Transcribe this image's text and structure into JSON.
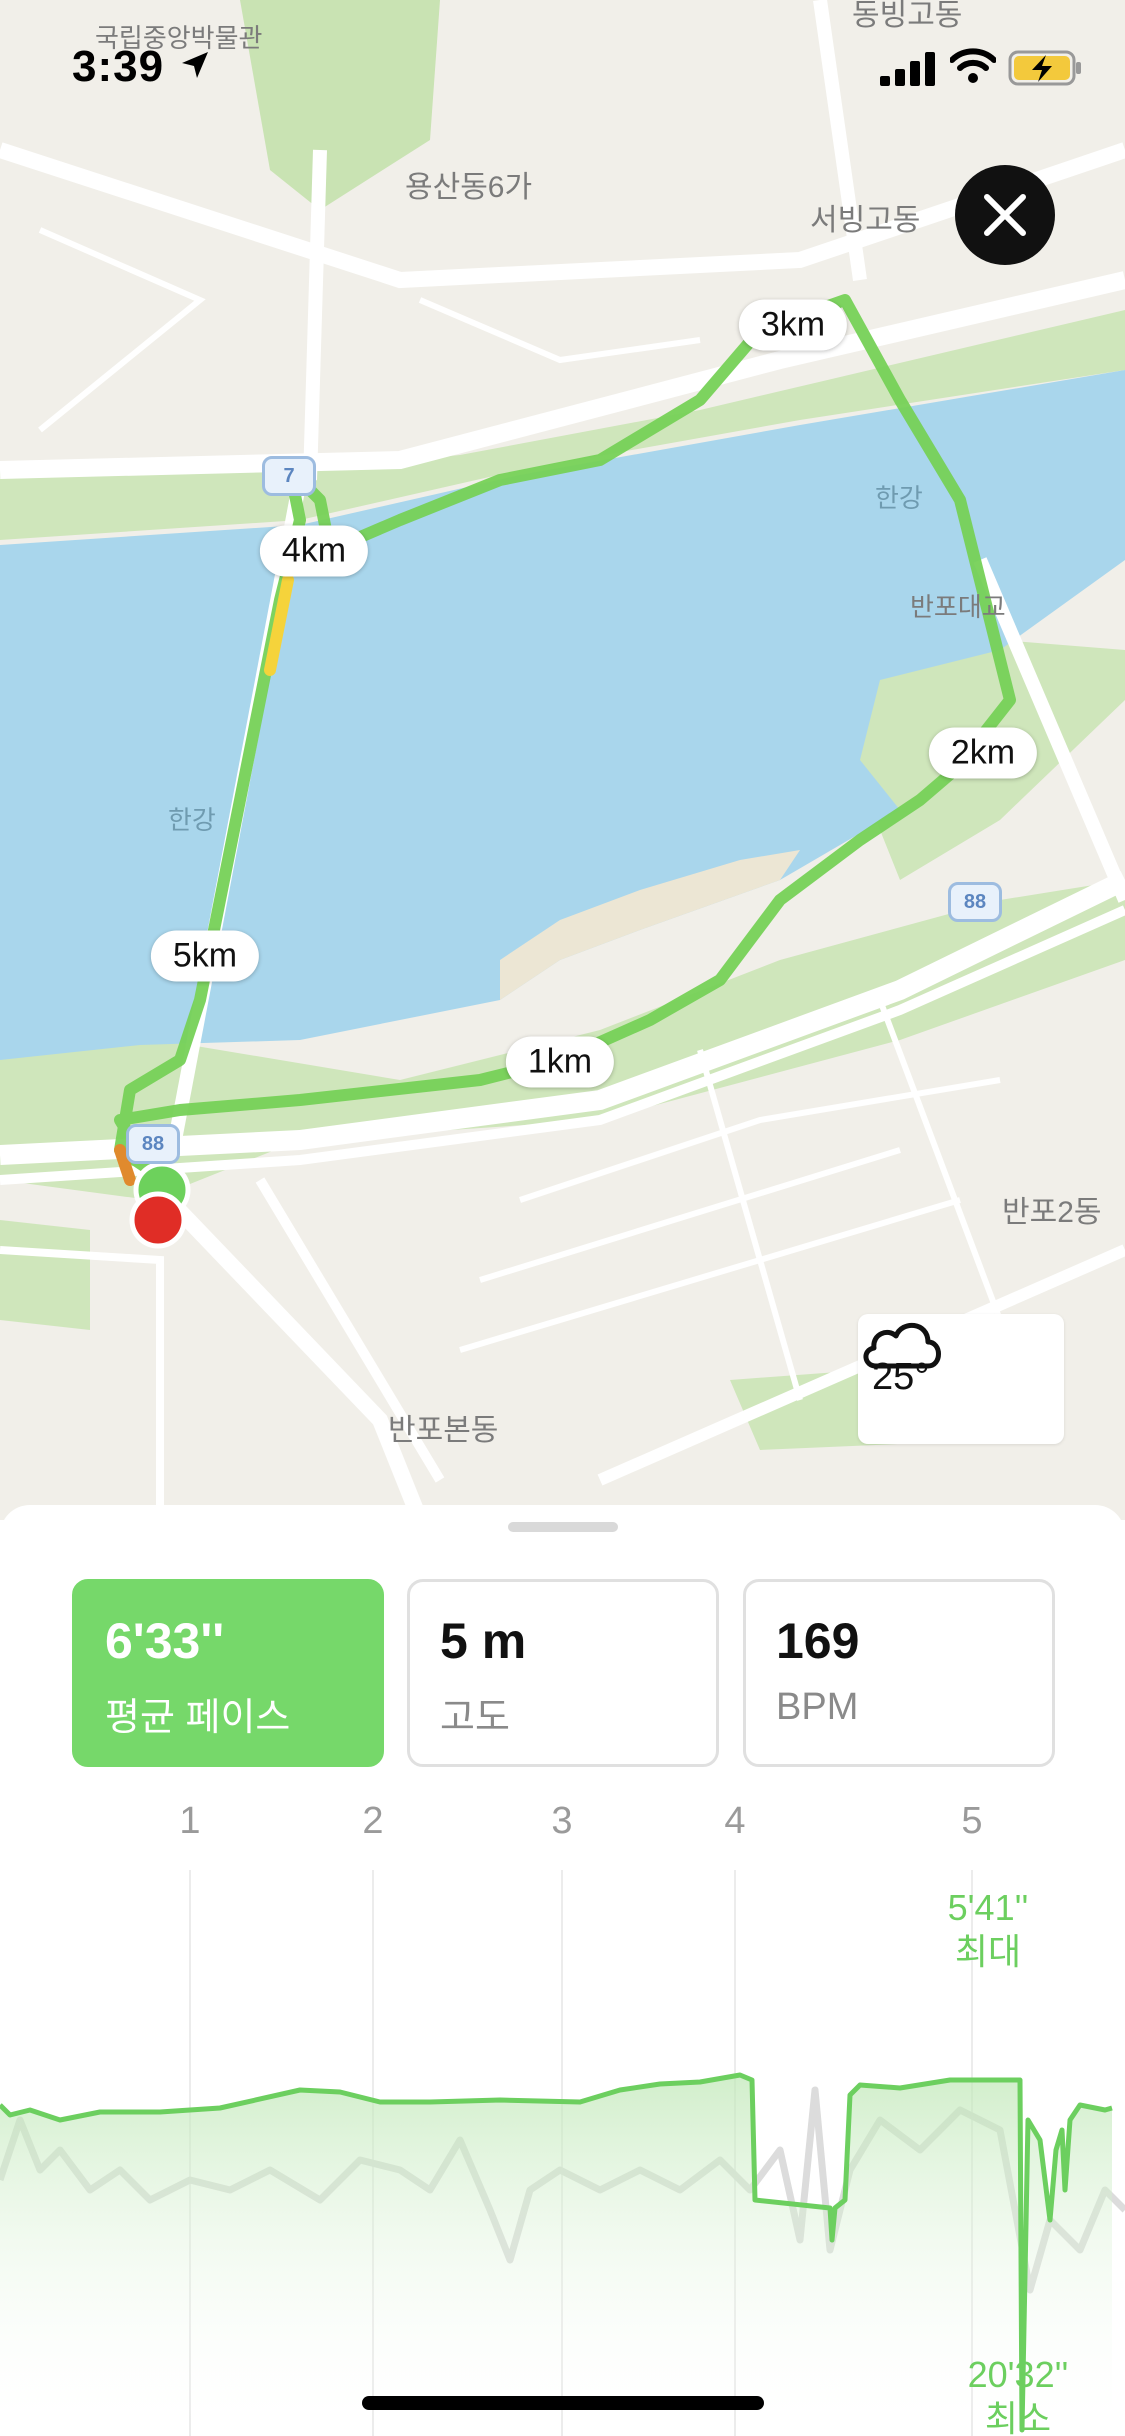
{
  "status_bar": {
    "time": "3:39",
    "location_icon": "location-arrow-icon",
    "signal_icon": "cellular-signal-icon",
    "wifi_icon": "wifi-icon",
    "battery_icon": "battery-charging-icon"
  },
  "map": {
    "labels": {
      "museum": "국립중앙박물관",
      "yongsan": "용산동6가",
      "seobinggo": "서빙고동",
      "dongbinggo": "동빙고동",
      "hangang_east": "한강",
      "hangang_west": "한강",
      "banpo_bridge": "반포대교",
      "banpo2": "반포2동",
      "banpobon": "반포본동"
    },
    "route_signs": [
      "88",
      "88",
      "7"
    ],
    "distance_markers": [
      "1km",
      "2km",
      "3km",
      "4km",
      "5km"
    ],
    "colors": {
      "water": "#a9d6ec",
      "park": "#c9e3b3",
      "route": "#76d157",
      "start": "#6dd15c",
      "end": "#e02d26"
    }
  },
  "close_button": {
    "icon": "close-icon"
  },
  "weather": {
    "temperature": "25°",
    "icon": "cloud-icon"
  },
  "metrics": [
    {
      "value": "6'33''",
      "label": "평균 페이스",
      "active": true
    },
    {
      "value": "5 m",
      "label": "고도",
      "active": false
    },
    {
      "value": "169",
      "label": "BPM",
      "active": false
    }
  ],
  "chart": {
    "km_ticks": [
      "1",
      "2",
      "3",
      "4",
      "5"
    ],
    "max_value": "5'41''",
    "max_label": "최대",
    "min_value": "20'32''",
    "min_label": "최소",
    "colors": {
      "pace": "#6ccf5f",
      "elevation": "#d9d9d9"
    }
  }
}
